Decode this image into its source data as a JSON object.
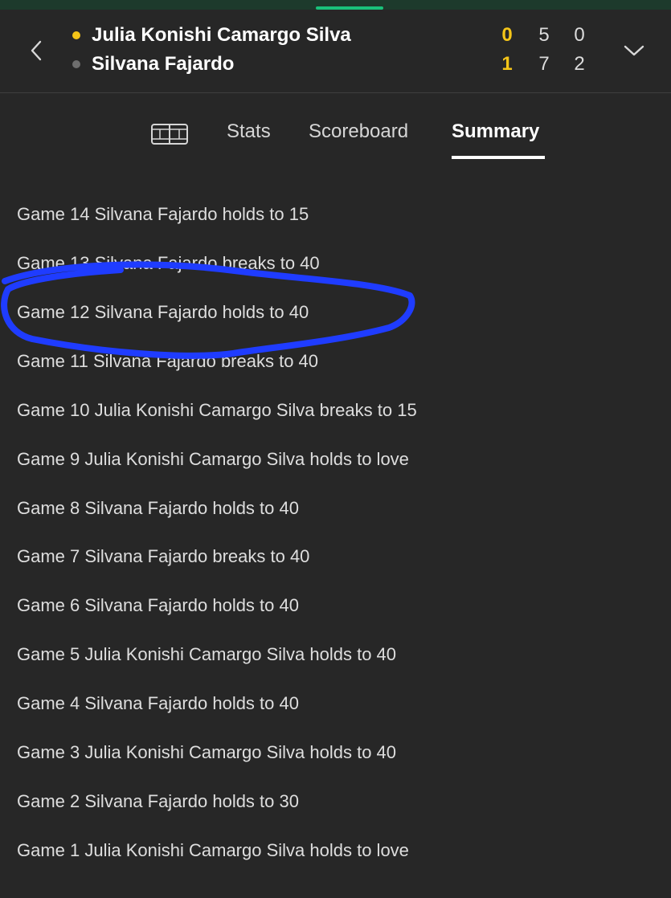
{
  "match": {
    "players": [
      {
        "name": "Julia Konishi Camargo Silva",
        "serve_color": "#f5c518",
        "scores": [
          "0",
          "5",
          "0"
        ]
      },
      {
        "name": "Silvana Fajardo",
        "serve_color": "#6e6e6e",
        "scores": [
          "1",
          "7",
          "2"
        ]
      }
    ],
    "sets_color": "#f5c518"
  },
  "icons": {
    "back": "chevron-left-icon",
    "expand": "chevron-down-icon",
    "court": "court-icon"
  },
  "tabs": [
    {
      "label": "Stats"
    },
    {
      "label": "Scoreboard"
    },
    {
      "label": "Summary",
      "active": true
    }
  ],
  "summary": [
    "Game 14 Silvana Fajardo holds to 15",
    "Game 13 Silvana Fajardo breaks to 40",
    "Game 12 Silvana Fajardo holds to 40",
    "Game 11 Silvana Fajardo breaks to 40",
    "Game 10 Julia Konishi Camargo Silva breaks to 15",
    "Game 9 Julia Konishi Camargo Silva holds to love",
    "Game 8 Silvana Fajardo holds to 40",
    "Game 7 Silvana Fajardo breaks to 40",
    "Game 6 Silvana Fajardo holds to 40",
    "Game 5 Julia Konishi Camargo Silva holds to 40",
    "Game 4 Silvana Fajardo holds to 40",
    "Game 3 Julia Konishi Camargo Silva holds to 40",
    "Game 2 Silvana Fajardo holds to 30",
    "Game 1 Julia Konishi Camargo Silva holds to love"
  ],
  "annotation": {
    "color": "#1f3cff",
    "highlighted_item": "Game 12 Silvana Fajardo holds to 40"
  }
}
